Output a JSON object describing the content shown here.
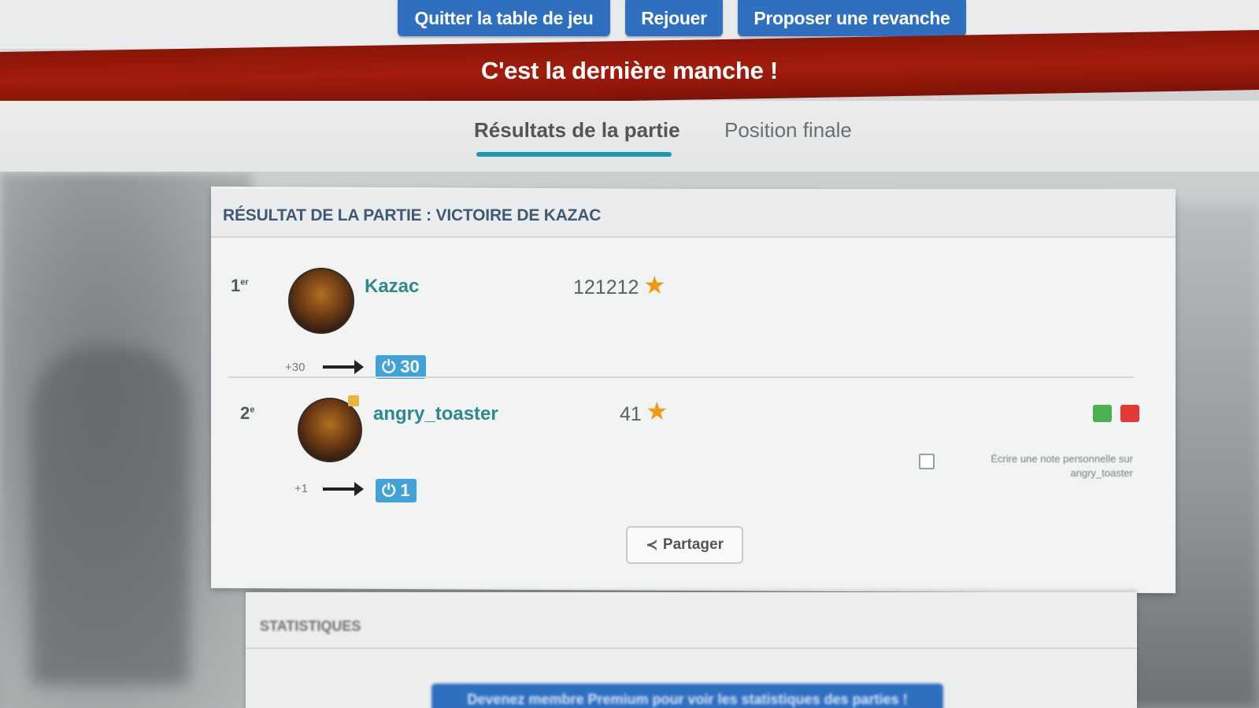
{
  "top_actions": {
    "quit_label": "Quitter la table de jeu",
    "replay_label": "Rejouer",
    "rematch_label": "Proposer une revanche"
  },
  "banner": {
    "text": "C'est la dernière manche !"
  },
  "tabs": [
    {
      "label": "Résultats de la partie",
      "active": true
    },
    {
      "label": "Position finale",
      "active": false
    }
  ],
  "result": {
    "title": "RÉSULTAT DE LA PARTIE : VICTOIRE DE KAZAC",
    "players": [
      {
        "rank": "1",
        "rank_suffix": "er",
        "name": "Kazac",
        "score": "121212",
        "delta": "+30",
        "points": "30"
      },
      {
        "rank": "2",
        "rank_suffix": "e",
        "name": "angry_toaster",
        "score": "41",
        "delta": "+1",
        "points": "1"
      }
    ],
    "note_label": "Écrire une note personnelle sur angry_toaster",
    "share_label": "Partager"
  },
  "stats": {
    "title": "STATISTIQUES",
    "premium_label": "Devenez membre Premium pour voir les statistiques des parties !"
  },
  "colors": {
    "button_blue": "#2f6fc0",
    "banner_red": "#a31c0c",
    "tab_underline": "#1b9ab0",
    "player_name": "#2c8a8e",
    "star": "#ef9a14"
  }
}
